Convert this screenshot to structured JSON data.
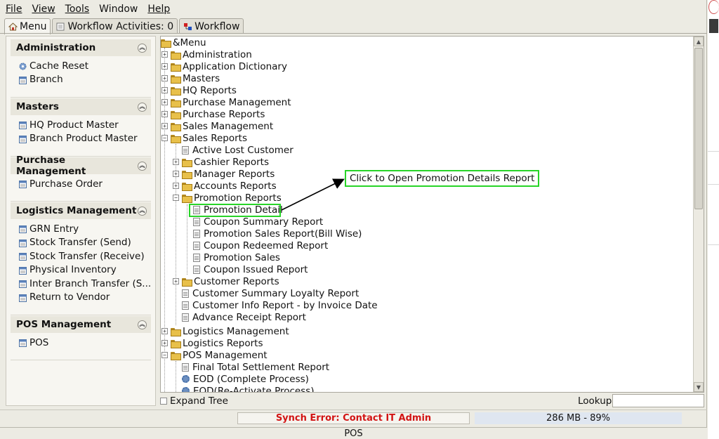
{
  "menubar": {
    "file": "File",
    "view": "View",
    "tools": "Tools",
    "window": "Window",
    "help": "Help"
  },
  "tabs": [
    {
      "label": "Menu"
    },
    {
      "label": "Workflow Activities: 0"
    },
    {
      "label": "Workflow"
    }
  ],
  "sidebar": {
    "administration": {
      "title": "Administration",
      "items": [
        "Cache Reset",
        "Branch"
      ]
    },
    "masters": {
      "title": "Masters",
      "items": [
        "HQ Product Master",
        "Branch Product Master"
      ]
    },
    "purchase": {
      "title": "Purchase Management",
      "items": [
        "Purchase Order"
      ]
    },
    "logistics": {
      "title": "Logistics Management",
      "items": [
        "GRN Entry",
        "Stock Transfer (Send)",
        "Stock Transfer (Receive)",
        "Physical Inventory",
        "Inter Branch Transfer (S...",
        "Return to Vendor"
      ]
    },
    "pos": {
      "title": "POS Management",
      "items": [
        "POS"
      ]
    }
  },
  "tree": {
    "root": "&Menu",
    "nodes": [
      "Administration",
      "Application Dictionary",
      "Masters",
      "HQ Reports",
      "Purchase Management",
      "Purchase Reports",
      "Sales Management",
      "Sales Reports",
      "Active Lost Customer",
      "Cashier Reports",
      "Manager Reports",
      "Accounts Reports",
      "Promotion Reports",
      "Promotion Detail",
      "Coupon Summary Report",
      "Promotion Sales Report(Bill Wise)",
      "Coupon Redeemed Report",
      "Promotion Sales",
      "Coupon Issued Report",
      "Customer Reports",
      "Customer Summary Loyalty Report",
      "Customer Info Report - by Invoice Date",
      "Advance Receipt Report",
      "Logistics Management",
      "Logistics Reports",
      "POS Management",
      "Final Total Settlement Report",
      "EOD (Complete Process)",
      "EOD(Re-Activate Process)"
    ]
  },
  "annotation": {
    "callout": "Click to Open Promotion Details Report",
    "highlight_color": "#28d428"
  },
  "controls": {
    "expand_tree": "Expand Tree",
    "lookup_label": "Lookup",
    "lookup_value": ""
  },
  "status": {
    "sync_error": "Synch Error: Contact IT Admin",
    "memory": "286 MB - 89%",
    "footer": "POS"
  },
  "colors": {
    "error": "#d21414",
    "memory_bg": "#dfe6f0",
    "folder": "#e8c04a"
  }
}
